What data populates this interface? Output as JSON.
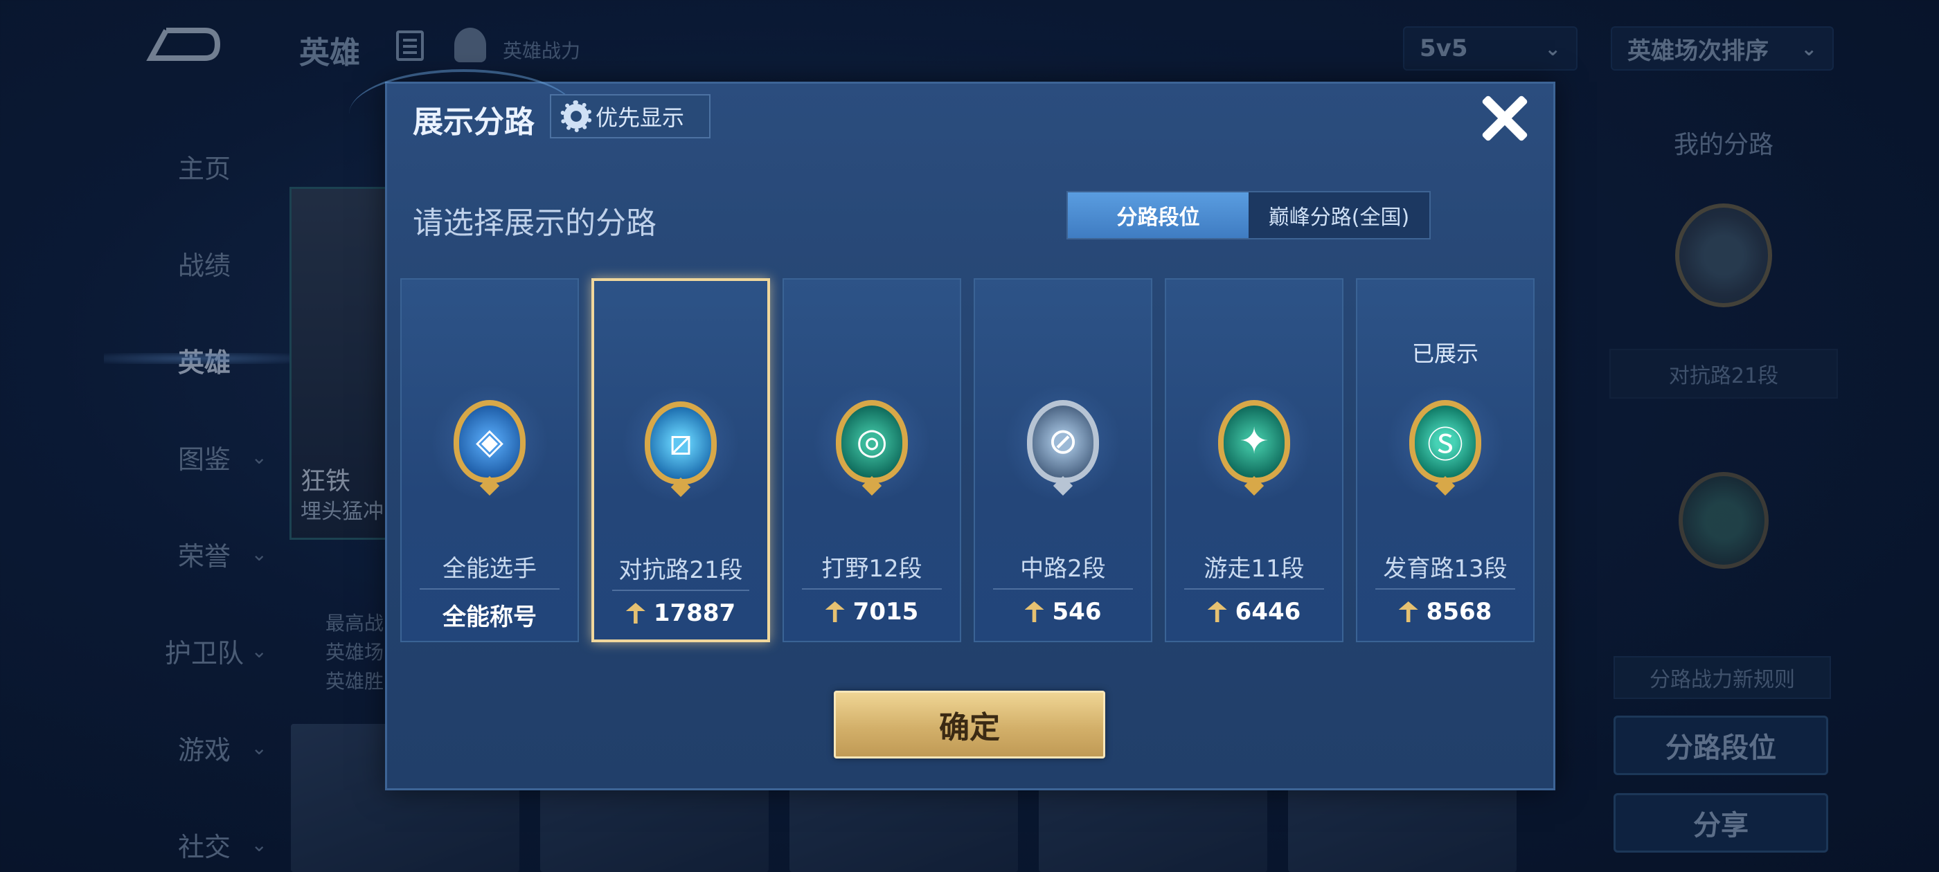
{
  "background": {
    "top": {
      "title": "英雄",
      "power_label": "英雄战力",
      "mode_select": "5v5",
      "sort_select": "英雄场次排序"
    },
    "nav": [
      {
        "label": "主页",
        "chevron": false
      },
      {
        "label": "战绩",
        "chevron": false
      },
      {
        "label": "英雄",
        "chevron": false,
        "active": true
      },
      {
        "label": "图鉴",
        "chevron": true
      },
      {
        "label": "荣誉",
        "chevron": true
      },
      {
        "label": "护卫队",
        "chevron": true
      },
      {
        "label": "游戏",
        "chevron": true
      },
      {
        "label": "社交",
        "chevron": true
      }
    ],
    "hero": {
      "name": "狂铁",
      "subtitle": "埋头猛冲",
      "stats": [
        "最高战",
        "英雄场",
        "英雄胜"
      ]
    },
    "right": {
      "title": "我的分路",
      "lane_label": "对抗路21段",
      "rule_tag": "分路战力新规则",
      "lane_button": "分路段位",
      "share_button": "分享"
    }
  },
  "modal": {
    "title": "展示分路",
    "priority_button": "优先显示",
    "subtitle": "请选择展示的分路",
    "tabs": [
      {
        "label": "分路段位",
        "active": true
      },
      {
        "label": "巅峰分路(全国)",
        "active": false
      }
    ],
    "cards": [
      {
        "lane": "全能选手",
        "value": "全能称号",
        "has_power_icon": false,
        "selected": false,
        "shown_label": "",
        "emblem": "all-round-emblem-icon",
        "emblem_class": "em-blue",
        "glyph": "◈"
      },
      {
        "lane": "对抗路21段",
        "value": "17887",
        "has_power_icon": true,
        "selected": true,
        "shown_label": "",
        "emblem": "clash-lane-emblem-icon",
        "emblem_class": "em-cyan",
        "glyph": "⧄"
      },
      {
        "lane": "打野12段",
        "value": "7015",
        "has_power_icon": true,
        "selected": false,
        "shown_label": "",
        "emblem": "jungle-emblem-icon",
        "emblem_class": "em-green",
        "glyph": "◎"
      },
      {
        "lane": "中路2段",
        "value": "546",
        "has_power_icon": true,
        "selected": false,
        "shown_label": "",
        "emblem": "mid-lane-emblem-icon",
        "emblem_class": "em-silver",
        "glyph": "⊘"
      },
      {
        "lane": "游走11段",
        "value": "6446",
        "has_power_icon": true,
        "selected": false,
        "shown_label": "",
        "emblem": "roam-emblem-icon",
        "emblem_class": "em-green",
        "glyph": "✦"
      },
      {
        "lane": "发育路13段",
        "value": "8568",
        "has_power_icon": true,
        "selected": false,
        "shown_label": "已展示",
        "emblem": "farm-lane-emblem-icon",
        "emblem_class": "em-teal",
        "glyph": "Ⓢ"
      }
    ],
    "confirm_button": "确定"
  }
}
